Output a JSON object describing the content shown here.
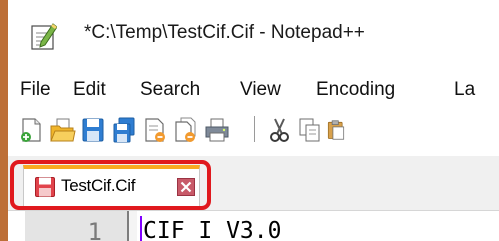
{
  "window": {
    "title": "*C:\\Temp\\TestCif.Cif - Notepad++",
    "icon": "notepad-plus-plus-icon"
  },
  "menu": {
    "items": [
      "File",
      "Edit",
      "Search",
      "View",
      "Encoding",
      "La"
    ]
  },
  "toolbar": {
    "buttons": [
      "new-file-icon",
      "open-folder-icon",
      "save-icon",
      "save-all-icon",
      "close-icon",
      "close-all-icon",
      "print-icon",
      "cut-icon",
      "copy-icon",
      "paste-icon"
    ]
  },
  "tabs": [
    {
      "label": "TestCif.Cif",
      "icon": "unsaved-file-icon",
      "close_icon": "tab-close-icon",
      "active": true
    }
  ],
  "editor": {
    "line_number": "1",
    "first_line": "CIF_I_V3.0"
  },
  "colors": {
    "frame": "#bd6f37",
    "active_tab_accent": "#f9a823",
    "highlight": "#e0191e",
    "caret": "#8000ff"
  }
}
